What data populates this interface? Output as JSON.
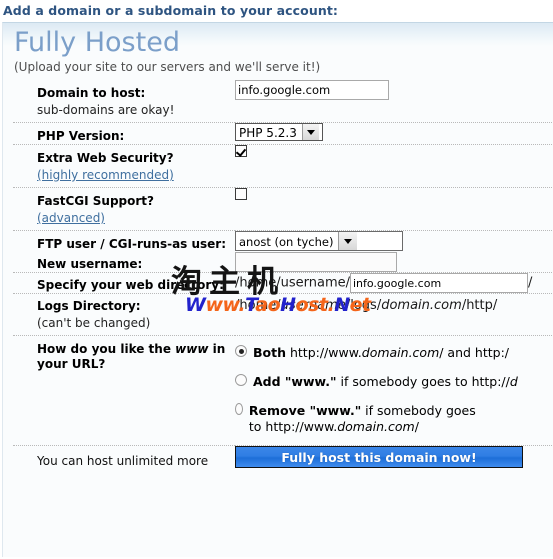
{
  "page": {
    "heading": "Add a domain or a subdomain to your account:"
  },
  "panel": {
    "title": "Fully Hosted",
    "subtitle": "(Upload your site to our servers and we'll serve it!)"
  },
  "fields": {
    "domain": {
      "label": "Domain to host:",
      "note": "sub-domains are okay!",
      "value": "info.google.com"
    },
    "php": {
      "label": "PHP Version:",
      "value": "PHP 5.2.3",
      "options": [
        "PHP 5.2.3"
      ]
    },
    "security": {
      "label": "Extra Web Security?",
      "note": "(highly recommended)",
      "checked": true
    },
    "fastcgi": {
      "label": "FastCGI Support?",
      "note": "(advanced)",
      "checked": false
    },
    "ftpuser": {
      "label": "FTP user / CGI-runs-as user:",
      "value": "anost (on tyche)",
      "options": [
        "anost (on tyche)"
      ]
    },
    "newusername": {
      "label": "New username:",
      "value": "",
      "placeholder": ""
    },
    "webdir": {
      "label": "Specify your web directory:",
      "prefix": "/home/username/",
      "value": "info.google.com",
      "suffix": "/"
    },
    "logsdir": {
      "label": "Logs Directory:",
      "note": "(can't be changed)",
      "prefix": "/home/",
      "em1": "username",
      "mid": "/logs/",
      "em2": "domain.com",
      "suffix": "/http/"
    },
    "www": {
      "label": "How do you like the www in your URL?",
      "label_part1": "How do you like the ",
      "label_em": "www",
      "label_part2": " in your URL?",
      "options": [
        {
          "id": "both",
          "bold": "Both",
          "rest_pre": " http://www.",
          "rest_em": "domain.com",
          "rest_post": "/ and http:/",
          "selected": true
        },
        {
          "id": "add",
          "bold": "Add \"www.\"",
          "rest_pre": " if somebody goes to http://",
          "rest_em": "d",
          "rest_post": "",
          "selected": false
        },
        {
          "id": "remove",
          "bold": "Remove \"www.\"",
          "rest_pre": " if somebody goes to http://www.",
          "rest_em": "domain.com",
          "rest_post": "/",
          "selected": false
        }
      ]
    }
  },
  "footer": {
    "note": "You can host unlimited more",
    "submit_label": "Fully host this domain now!"
  },
  "watermark": {
    "cn": "淘主机",
    "url_part1": "W",
    "url_part2": "ww.",
    "url_part3": "T",
    "url_part4": "ao",
    "url_part5": "H",
    "url_part6": "ost.",
    "url_part7": "N",
    "url_part8": "et",
    "full": "Www.TaoHost.Net"
  },
  "colors": {
    "heading": "#2e5481",
    "panel_title": "#7b9fc9",
    "link": "#3f6f9f",
    "button": "#2f7ee4",
    "watermark_orange": "#f4651a",
    "watermark_blue": "#2222cc"
  }
}
